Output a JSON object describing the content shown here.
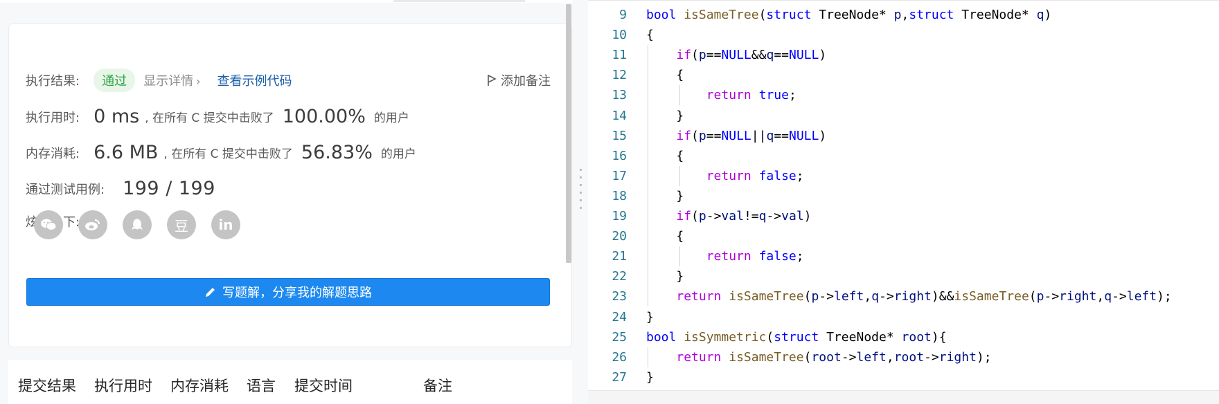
{
  "result": {
    "status_label": "执行结果:",
    "status_badge": "通过",
    "details_link": "显示详情",
    "sample_code_link": "查看示例代码",
    "add_note": "添加备注",
    "runtime_label": "执行用时:",
    "runtime_value": "0 ms",
    "runtime_text": ", 在所有 C 提交中击败了",
    "runtime_percent": "100.00%",
    "runtime_users": "的用户",
    "memory_label": "内存消耗:",
    "memory_value": "6.6 MB",
    "memory_text": ", 在所有 C 提交中击败了",
    "memory_percent": "56.83%",
    "memory_users": "的用户",
    "cases_label": "通过测试用例:",
    "cases_value": "199 / 199",
    "share_label": "炫耀一下:",
    "share_icons": [
      "wechat-icon",
      "weibo-icon",
      "qq-icon",
      "douban-icon",
      "linkedin-icon"
    ],
    "douban_glyph": "豆",
    "linkedin_glyph": "in",
    "solution_button": "写题解，分享我的解题思路"
  },
  "history": {
    "columns": [
      "提交结果",
      "执行用时",
      "内存消耗",
      "语言",
      "提交时间",
      "备注"
    ]
  },
  "editor": {
    "lines": [
      {
        "n": "9",
        "tokens": [
          [
            "kw",
            "bool"
          ],
          [
            "ty",
            " "
          ],
          [
            "fn",
            "isSameTree"
          ],
          [
            "ty",
            "("
          ],
          [
            "kw",
            "struct"
          ],
          [
            "ty",
            " TreeNode* "
          ],
          [
            "var",
            "p"
          ],
          [
            "ty",
            ","
          ],
          [
            "kw",
            "struct"
          ],
          [
            "ty",
            " TreeNode* "
          ],
          [
            "var",
            "q"
          ],
          [
            "ty",
            ")"
          ]
        ]
      },
      {
        "n": "10",
        "tokens": [
          [
            "ty",
            "{"
          ]
        ]
      },
      {
        "n": "11",
        "tokens": [
          [
            "ty",
            "    "
          ],
          [
            "ctl",
            "if"
          ],
          [
            "ty",
            "("
          ],
          [
            "var",
            "p"
          ],
          [
            "ty",
            "=="
          ],
          [
            "kw",
            "NULL"
          ],
          [
            "ty",
            "&&"
          ],
          [
            "var",
            "q"
          ],
          [
            "ty",
            "=="
          ],
          [
            "kw",
            "NULL"
          ],
          [
            "ty",
            ")"
          ]
        ]
      },
      {
        "n": "12",
        "tokens": [
          [
            "ty",
            "    {"
          ]
        ]
      },
      {
        "n": "13",
        "tokens": [
          [
            "ty",
            "        "
          ],
          [
            "ctl",
            "return"
          ],
          [
            "ty",
            " "
          ],
          [
            "kw",
            "true"
          ],
          [
            "ty",
            ";"
          ]
        ]
      },
      {
        "n": "14",
        "tokens": [
          [
            "ty",
            "    }"
          ]
        ]
      },
      {
        "n": "15",
        "tokens": [
          [
            "ty",
            "    "
          ],
          [
            "ctl",
            "if"
          ],
          [
            "ty",
            "("
          ],
          [
            "var",
            "p"
          ],
          [
            "ty",
            "=="
          ],
          [
            "kw",
            "NULL"
          ],
          [
            "ty",
            "||"
          ],
          [
            "var",
            "q"
          ],
          [
            "ty",
            "=="
          ],
          [
            "kw",
            "NULL"
          ],
          [
            "ty",
            ")"
          ]
        ]
      },
      {
        "n": "16",
        "tokens": [
          [
            "ty",
            "    {"
          ]
        ]
      },
      {
        "n": "17",
        "tokens": [
          [
            "ty",
            "        "
          ],
          [
            "ctl",
            "return"
          ],
          [
            "ty",
            " "
          ],
          [
            "kw",
            "false"
          ],
          [
            "ty",
            ";"
          ]
        ]
      },
      {
        "n": "18",
        "tokens": [
          [
            "ty",
            "    }"
          ]
        ]
      },
      {
        "n": "19",
        "tokens": [
          [
            "ty",
            "    "
          ],
          [
            "ctl",
            "if"
          ],
          [
            "ty",
            "("
          ],
          [
            "var",
            "p"
          ],
          [
            "ty",
            "->"
          ],
          [
            "var",
            "val"
          ],
          [
            "ty",
            "!="
          ],
          [
            "var",
            "q"
          ],
          [
            "ty",
            "->"
          ],
          [
            "var",
            "val"
          ],
          [
            "ty",
            ")"
          ]
        ]
      },
      {
        "n": "20",
        "tokens": [
          [
            "ty",
            "    {"
          ]
        ]
      },
      {
        "n": "21",
        "tokens": [
          [
            "ty",
            "        "
          ],
          [
            "ctl",
            "return"
          ],
          [
            "ty",
            " "
          ],
          [
            "kw",
            "false"
          ],
          [
            "ty",
            ";"
          ]
        ]
      },
      {
        "n": "22",
        "tokens": [
          [
            "ty",
            "    }"
          ]
        ]
      },
      {
        "n": "23",
        "tokens": [
          [
            "ty",
            "    "
          ],
          [
            "ctl",
            "return"
          ],
          [
            "ty",
            " "
          ],
          [
            "fn",
            "isSameTree"
          ],
          [
            "ty",
            "("
          ],
          [
            "var",
            "p"
          ],
          [
            "ty",
            "->"
          ],
          [
            "var",
            "left"
          ],
          [
            "ty",
            ","
          ],
          [
            "var",
            "q"
          ],
          [
            "ty",
            "->"
          ],
          [
            "var",
            "right"
          ],
          [
            "ty",
            ")&&"
          ],
          [
            "fn",
            "isSameTree"
          ],
          [
            "ty",
            "("
          ],
          [
            "var",
            "p"
          ],
          [
            "ty",
            "->"
          ],
          [
            "var",
            "right"
          ],
          [
            "ty",
            ","
          ],
          [
            "var",
            "q"
          ],
          [
            "ty",
            "->"
          ],
          [
            "var",
            "left"
          ],
          [
            "ty",
            ");"
          ]
        ]
      },
      {
        "n": "24",
        "tokens": [
          [
            "ty",
            "}"
          ]
        ]
      },
      {
        "n": "25",
        "tokens": [
          [
            "kw",
            "bool"
          ],
          [
            "ty",
            " "
          ],
          [
            "fn",
            "isSymmetric"
          ],
          [
            "ty",
            "("
          ],
          [
            "kw",
            "struct"
          ],
          [
            "ty",
            " TreeNode* "
          ],
          [
            "var",
            "root"
          ],
          [
            "ty",
            "){"
          ]
        ]
      },
      {
        "n": "26",
        "tokens": [
          [
            "ty",
            "    "
          ],
          [
            "ctl",
            "return"
          ],
          [
            "ty",
            " "
          ],
          [
            "fn",
            "isSameTree"
          ],
          [
            "ty",
            "("
          ],
          [
            "var",
            "root"
          ],
          [
            "ty",
            "->"
          ],
          [
            "var",
            "left"
          ],
          [
            "ty",
            ","
          ],
          [
            "var",
            "root"
          ],
          [
            "ty",
            "->"
          ],
          [
            "var",
            "right"
          ],
          [
            "ty",
            ");"
          ]
        ]
      },
      {
        "n": "27",
        "tokens": [
          [
            "ty",
            "}"
          ]
        ]
      }
    ]
  }
}
